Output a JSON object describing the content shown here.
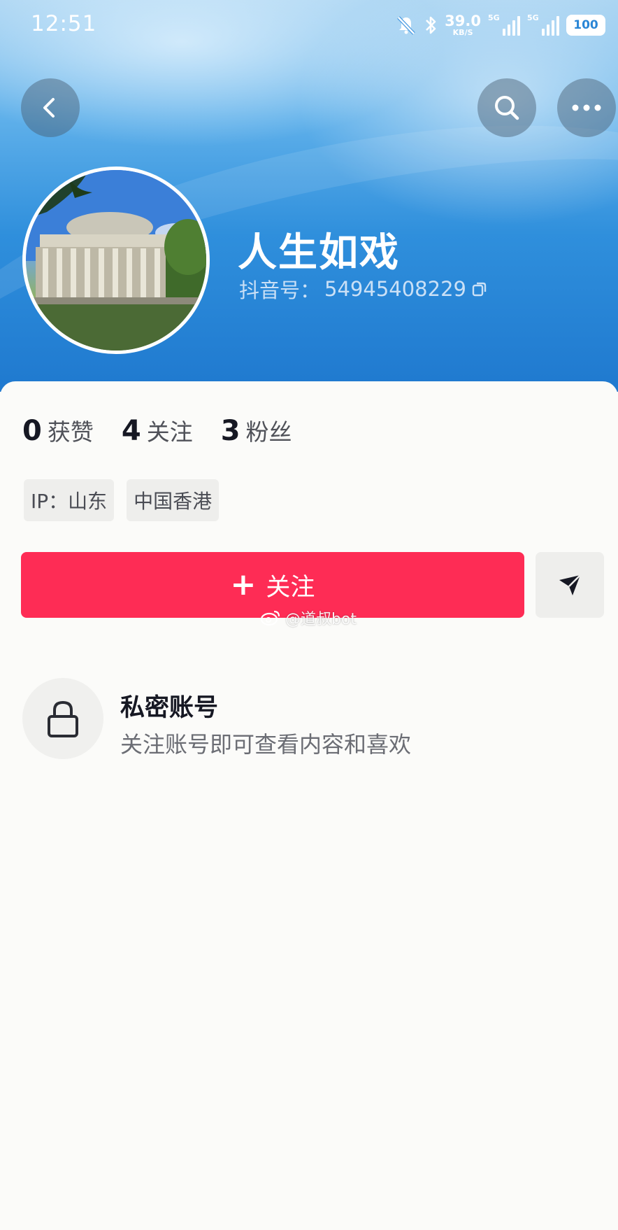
{
  "status_bar": {
    "time": "12:51",
    "speed_value": "39.0",
    "speed_unit": "KB/S",
    "signal1_label": "5G",
    "signal2_label": "5G",
    "battery": "100",
    "icons": [
      "mute-bell-icon",
      "bluetooth-icon",
      "signal-icon",
      "battery-icon"
    ]
  },
  "nav": {
    "back_icon": "chevron-left-icon",
    "search_icon": "search-icon",
    "more_icon": "more-dots-icon"
  },
  "profile": {
    "name": "人生如戏",
    "id_label": "抖音号：",
    "id_value": "54945408229",
    "copy_icon": "copy-icon"
  },
  "stats": [
    {
      "num": "0",
      "label": "获赞"
    },
    {
      "num": "4",
      "label": "关注"
    },
    {
      "num": "3",
      "label": "粉丝"
    }
  ],
  "tags": [
    "IP：山东",
    "中国香港"
  ],
  "actions": {
    "follow_label": "关注",
    "follow_plus": "+",
    "share_icon": "send-icon"
  },
  "watermark": "@道叔bot",
  "private": {
    "title": "私密账号",
    "description": "关注账号即可查看内容和喜欢"
  },
  "colors": {
    "follow": "#fe2c55",
    "header_top": "#a9d4f2",
    "header_bottom": "#1f79cf",
    "background": "#fbfbf9"
  }
}
